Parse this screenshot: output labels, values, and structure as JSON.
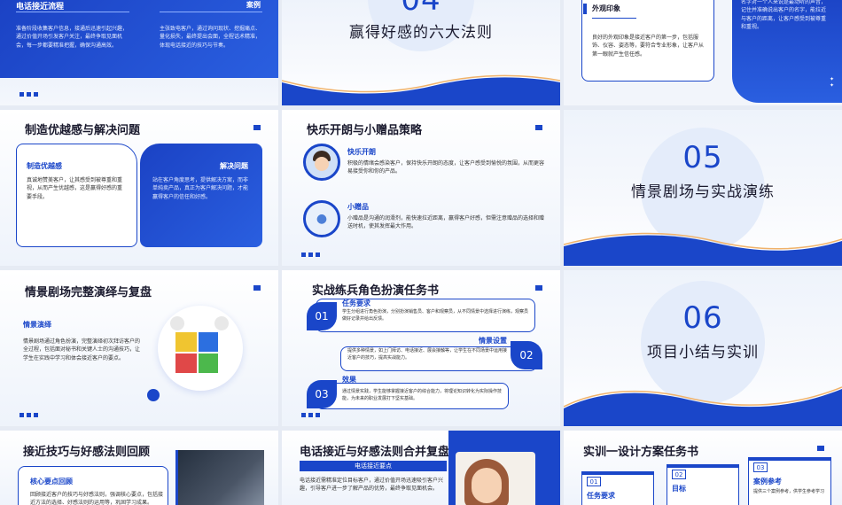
{
  "s1": {
    "title": "电话接近流程",
    "tag": "案例",
    "left_text": "准备阶段收集客户信息，接通后迅速引起兴趣，通过价值开场引发客户关注，最终争取见面机会，每一步都要精准把握，确保沟通高效。",
    "right_text": "主张致电客户，通过询问现状、挖掘痛点、量化损失，最终提出会面，全程话术精准，体现电话接近的技巧与节奏。"
  },
  "s2": {
    "num": "04",
    "title": "赢得好感的六大法则"
  },
  "s3": {
    "title": "外观印象",
    "text": "良好的外观印象是接近客户的第一步，包括服饰、仪容、姿态等，要符合专业形象，让客户从第一眼就产生信任感。",
    "side_text": "名字对一个人来说是最动听的声音，记住并准确说出客户的名字，能拉近与客户的距离，让客户感受到被尊重和重视。"
  },
  "s4": {
    "title": "制造优越感与解决问题",
    "left_head": "制造优越感",
    "left_text": "真诚地赞美客户，让其感受到被尊重和重视，从而产生优越感，这是赢得好感的重要手段。",
    "right_head": "解决问题",
    "right_text": "站在客户角度思考，提供解决方案，而非单纯卖产品，真正为客户解决问题，才能赢得客户的信任和好感。"
  },
  "s5": {
    "title": "快乐开朗与小赠品策略",
    "item1_head": "快乐开朗",
    "item1_text": "积极的情绪会感染客户，保持快乐开朗的态度，让客户感受到愉悦的氛围，从而更容易接受你和你的产品。",
    "item2_head": "小赠品",
    "item2_text": "小赠品是沟通的润滑剂，能快速拉近距离，赢得客户好感，但需注意赠品的选择和赠送时机，使其发挥最大作用。"
  },
  "s6": {
    "num": "05",
    "title": "情景剧场与实战演练"
  },
  "s7": {
    "title": "情景剧场完整演绎与复盘",
    "head": "情景演绎",
    "text": "情景剧场通过角色扮演，完整演绎初次拜访客户的全过程，包括面对秘书和关键人士的沟通技巧，让学生在实践中学习和体会接近客户的要点。"
  },
  "s8": {
    "title": "实战练兵角色扮演任务书",
    "items": [
      {
        "no": "01",
        "head": "任务要求",
        "text": "学生分组进行角色扮演，分别扮演销售员、客户和观察员，从不同情景中选择进行演练，观察员做好记录并给出反馈。"
      },
      {
        "no": "02",
        "head": "情景设置",
        "text": "提供多种情景，如上门拜访、电话接近、展会接触等，让学生在不同场景中运用接近客户的技巧，提高实战能力。"
      },
      {
        "no": "03",
        "head": "效果",
        "text": "通过情景实践，学生能够掌握接近客户的综合能力，将理论知识转化为实际操作技能，为未来的职业发展打下坚实基础。"
      }
    ]
  },
  "s9": {
    "num": "06",
    "title": "项目小结与实训"
  },
  "s10": {
    "title": "接近技巧与好感法则回顾",
    "head": "核心要点回顾",
    "text": "回顾接近客户的技巧与好感法则，强调核心要点，包括接近方法的选择、好感法则的运用等，巩固学习成果。"
  },
  "s11": {
    "title": "电话接近与好感法则合并复盘",
    "banner": "电话接近要点",
    "text": "电话接近需精准定位目标客户，通过价值开场迅速吸引客户兴趣，引导客户进一步了解产品的优势，最终争取见面机会。"
  },
  "s12": {
    "title": "实训一设计方案任务书",
    "steps": [
      {
        "no": "01",
        "label": "任务要求"
      },
      {
        "no": "02",
        "label": "目标"
      },
      {
        "no": "03",
        "label": "案例参考",
        "text": "提供三个案例参考，供学生参考学习"
      }
    ]
  }
}
